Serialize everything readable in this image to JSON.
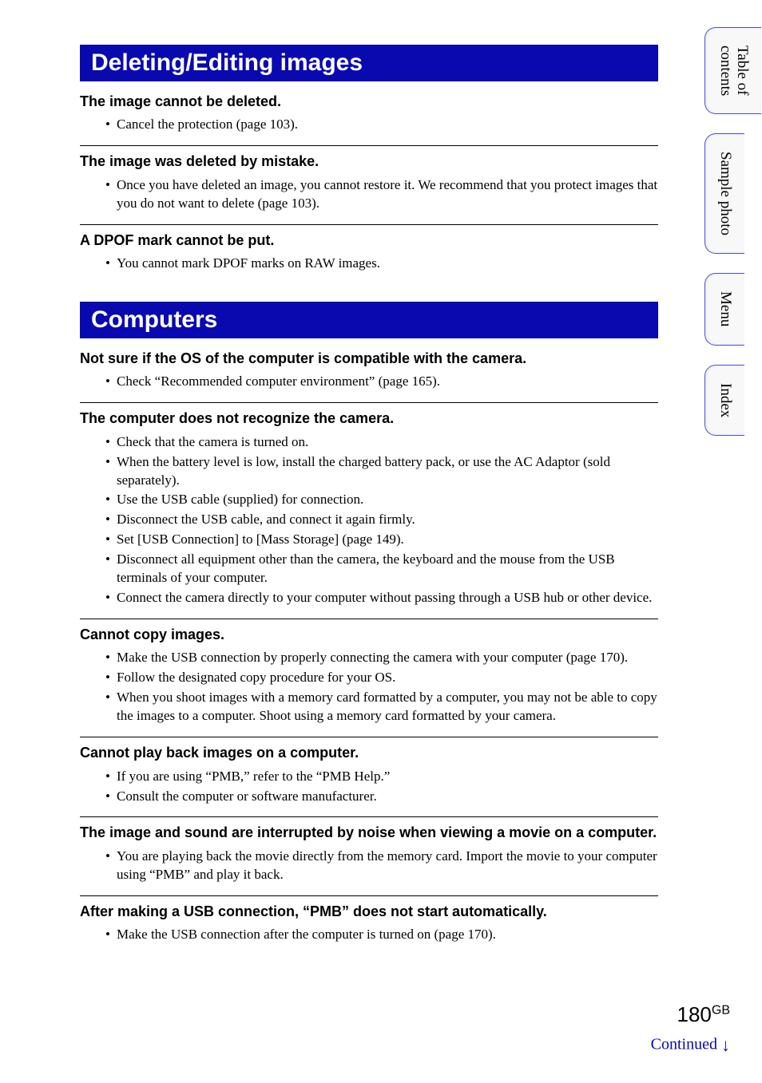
{
  "sidebar": {
    "tabs": [
      "Table of\ncontents",
      "Sample photo",
      "Menu",
      "Index"
    ]
  },
  "sections": [
    {
      "title": "Deleting/Editing images",
      "problems": [
        {
          "heading": "The image cannot be deleted.",
          "items": [
            "Cancel the protection (page 103)."
          ]
        },
        {
          "heading": "The image was deleted by mistake.",
          "items": [
            "Once you have deleted an image, you cannot restore it. We recommend that you protect images that you do not want to delete (page 103)."
          ]
        },
        {
          "heading": "A DPOF mark cannot be put.",
          "items": [
            "You cannot mark DPOF marks on RAW images."
          ]
        }
      ]
    },
    {
      "title": "Computers",
      "problems": [
        {
          "heading": "Not sure if the OS of the computer is compatible with the camera.",
          "items": [
            "Check “Recommended computer environment” (page 165)."
          ]
        },
        {
          "heading": "The computer does not recognize the camera.",
          "items": [
            "Check that the camera is turned on.",
            "When the battery level is low, install the charged battery pack, or use the AC Adaptor (sold separately).",
            "Use the USB cable (supplied) for connection.",
            "Disconnect the USB cable, and connect it again firmly.",
            "Set [USB Connection] to [Mass Storage] (page 149).",
            "Disconnect all equipment other than the camera, the keyboard and the mouse from the USB terminals of your computer.",
            "Connect the camera directly to your computer without passing through a USB hub or other device."
          ]
        },
        {
          "heading": "Cannot copy images.",
          "items": [
            "Make the USB connection by properly connecting the camera with your computer (page 170).",
            "Follow the designated copy procedure for your OS.",
            "When you shoot images with a memory card formatted by a computer, you may not be able to copy the images to a computer. Shoot using a memory card formatted by your camera."
          ]
        },
        {
          "heading": "Cannot play back images on a computer.",
          "items": [
            "If you are using “PMB,” refer to the “PMB Help.”",
            "Consult the computer or software manufacturer."
          ]
        },
        {
          "heading": "The image and sound are interrupted by noise when viewing a movie on a computer.",
          "items": [
            "You are playing back the movie directly from the memory card. Import the movie to your computer using “PMB” and play it back."
          ]
        },
        {
          "heading": "After making a USB connection, “PMB” does not start automatically.",
          "items": [
            "Make the USB connection after the computer is turned on (page 170)."
          ]
        }
      ]
    }
  ],
  "page_number": "180",
  "page_suffix": "GB",
  "continued_label": "Continued",
  "continued_arrow": "↓"
}
